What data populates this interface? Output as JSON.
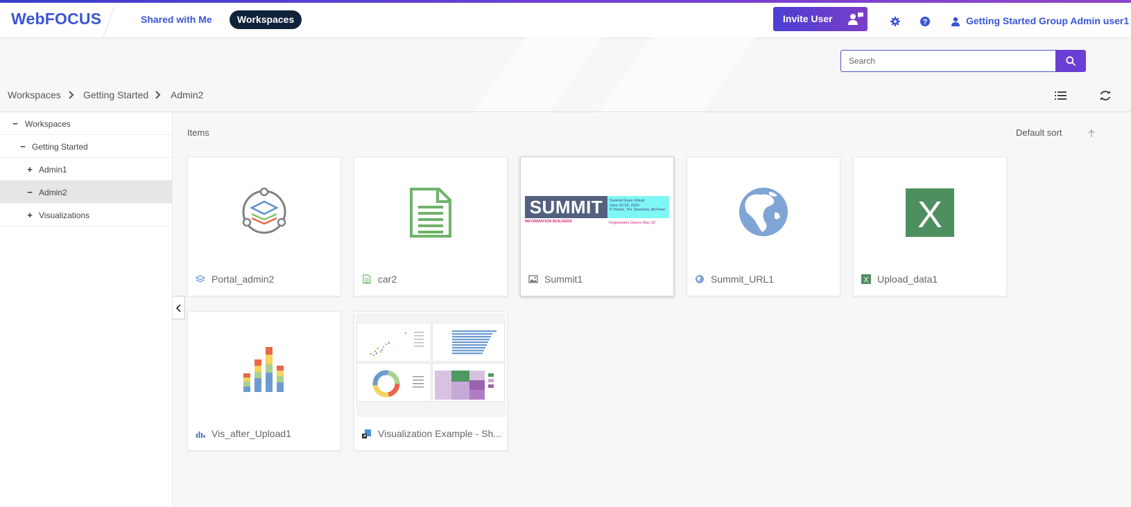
{
  "header": {
    "logo": "WebFOCUS",
    "nav": {
      "shared": "Shared with Me",
      "workspaces": "Workspaces"
    },
    "invite_label": "Invite User",
    "user_name": "Getting Started Group Admin user1",
    "accent": "#3a55d6",
    "active_tab_bg": "#10233b"
  },
  "search": {
    "placeholder": "Search",
    "value": ""
  },
  "breadcrumb": [
    "Workspaces",
    "Getting Started",
    "Admin2"
  ],
  "tree": [
    {
      "label": "Workspaces",
      "toggle": "−",
      "selected": false
    },
    {
      "label": "Getting Started",
      "toggle": "−",
      "selected": false
    },
    {
      "label": "Admin1",
      "toggle": "+",
      "selected": false
    },
    {
      "label": "Admin2",
      "toggle": "−",
      "selected": true
    },
    {
      "label": "Visualizations",
      "toggle": "+",
      "selected": false
    }
  ],
  "main": {
    "title": "Items",
    "sort_label": "Default sort"
  },
  "items": [
    {
      "name": "Portal_admin2",
      "type": "portal",
      "icon": "portal-icon"
    },
    {
      "name": "car2",
      "type": "document",
      "icon": "document-icon"
    },
    {
      "name": "Summit1",
      "type": "image",
      "icon": "image-icon",
      "selected": true
    },
    {
      "name": "Summit_URL1",
      "type": "url",
      "icon": "globe-icon"
    },
    {
      "name": "Upload_data1",
      "type": "excel",
      "icon": "excel-icon"
    },
    {
      "name": "Vis_after_Upload1",
      "type": "visualization",
      "icon": "chart-icon"
    },
    {
      "name": "Visualization Example - Sh...",
      "type": "shortcut",
      "icon": "shortcut-icon"
    }
  ],
  "summit_banner": {
    "title": "SUMMIT",
    "subtitle": "INFORMATION BUILDERS",
    "line1": "Summit Goes Virtual",
    "line2": "June 23-24, 2020",
    "line3": "8 Tracks, 70+ Sessions, All Free!",
    "registration": "Registration Opens May 18"
  }
}
